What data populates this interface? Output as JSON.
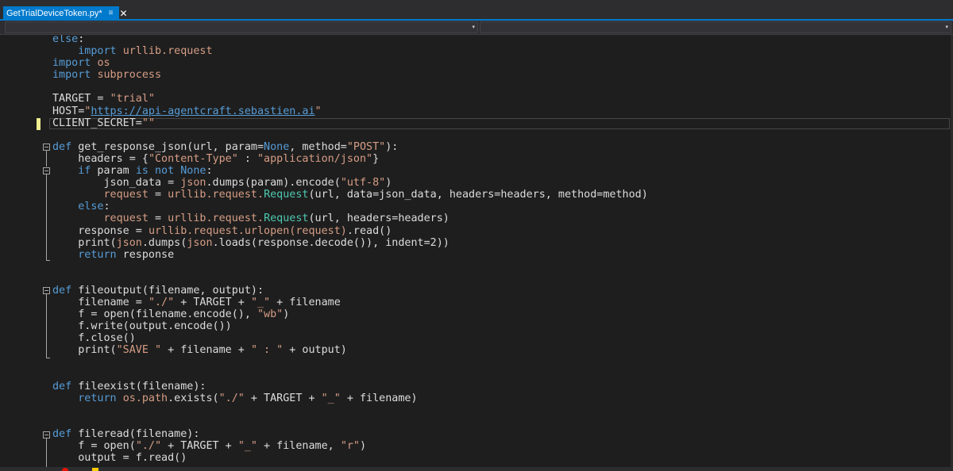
{
  "tab": {
    "title": "GetTrialDeviceToken.py*",
    "pin_glyph": "≡",
    "close_glyph": "✕"
  },
  "navbar": {
    "arrow_glyph": "▾"
  },
  "code": {
    "lines": [
      [
        [
          "kw",
          "else"
        ],
        [
          "t",
          ":"
        ]
      ],
      [
        [
          "t",
          "    "
        ],
        [
          "kw",
          "import"
        ],
        [
          "t",
          " "
        ],
        [
          "str",
          "urllib.request"
        ]
      ],
      [
        [
          "kw",
          "import"
        ],
        [
          "t",
          " "
        ],
        [
          "str",
          "os"
        ]
      ],
      [
        [
          "kw",
          "import"
        ],
        [
          "t",
          " "
        ],
        [
          "str",
          "subprocess"
        ]
      ],
      [],
      [
        [
          "t",
          "TARGET = "
        ],
        [
          "str",
          "\"trial\""
        ]
      ],
      [
        [
          "t",
          "HOST="
        ],
        [
          "str",
          "\""
        ],
        [
          "url",
          "https://api-agentcraft.sebastien.ai"
        ],
        [
          "str",
          "\""
        ]
      ],
      [
        [
          "t",
          "CLIENT_SECRET="
        ],
        [
          "str",
          "\"\""
        ]
      ],
      [],
      [
        [
          "kw",
          "def"
        ],
        [
          "t",
          " get_response_json(url, param="
        ],
        [
          "kw",
          "None"
        ],
        [
          "t",
          ", method="
        ],
        [
          "str",
          "\"POST\""
        ],
        [
          "t",
          "):"
        ]
      ],
      [
        [
          "t",
          "    headers = {"
        ],
        [
          "str",
          "\"Content-Type\""
        ],
        [
          "t",
          " : "
        ],
        [
          "str",
          "\"application/json\""
        ],
        [
          "t",
          "}"
        ]
      ],
      [
        [
          "t",
          "    "
        ],
        [
          "kw",
          "if"
        ],
        [
          "t",
          " param "
        ],
        [
          "kw",
          "is not None"
        ],
        [
          "t",
          ":"
        ]
      ],
      [
        [
          "t",
          "        json_data = "
        ],
        [
          "str",
          "json"
        ],
        [
          "t",
          ".dumps(param).encode("
        ],
        [
          "str",
          "\"utf-8\""
        ],
        [
          "t",
          ")"
        ]
      ],
      [
        [
          "t",
          "        "
        ],
        [
          "str",
          "request"
        ],
        [
          "t",
          " = "
        ],
        [
          "str",
          "urllib.request."
        ],
        [
          "cls",
          "Request"
        ],
        [
          "t",
          "(url, data=json_data, headers=headers, method=method)"
        ]
      ],
      [
        [
          "t",
          "    "
        ],
        [
          "kw",
          "else"
        ],
        [
          "t",
          ":"
        ]
      ],
      [
        [
          "t",
          "        "
        ],
        [
          "str",
          "request"
        ],
        [
          "t",
          " = "
        ],
        [
          "str",
          "urllib.request."
        ],
        [
          "cls",
          "Request"
        ],
        [
          "t",
          "(url, headers=headers)"
        ]
      ],
      [
        [
          "t",
          "    response = "
        ],
        [
          "str",
          "urllib.request.urlopen(request)"
        ],
        [
          "t",
          ".read()"
        ]
      ],
      [
        [
          "t",
          "    print("
        ],
        [
          "str",
          "json"
        ],
        [
          "t",
          ".dumps("
        ],
        [
          "str",
          "json"
        ],
        [
          "t",
          ".loads(response.decode()), indent=2))"
        ]
      ],
      [
        [
          "t",
          "    "
        ],
        [
          "kw",
          "return"
        ],
        [
          "t",
          " response"
        ]
      ],
      [],
      [],
      [
        [
          "kw",
          "def"
        ],
        [
          "t",
          " fileoutput(filename, output):"
        ]
      ],
      [
        [
          "t",
          "    filename = "
        ],
        [
          "str",
          "\"./\""
        ],
        [
          "t",
          " + TARGET + "
        ],
        [
          "str",
          "\"_\""
        ],
        [
          "t",
          " + filename"
        ]
      ],
      [
        [
          "t",
          "    f = open(filename.encode(), "
        ],
        [
          "str",
          "\"wb\""
        ],
        [
          "t",
          ")"
        ]
      ],
      [
        [
          "t",
          "    f.write(output.encode())"
        ]
      ],
      [
        [
          "t",
          "    f.close()"
        ]
      ],
      [
        [
          "t",
          "    print("
        ],
        [
          "str",
          "\"SAVE \""
        ],
        [
          "t",
          " + filename + "
        ],
        [
          "str",
          "\" : \""
        ],
        [
          "t",
          " + output)"
        ]
      ],
      [],
      [],
      [
        [
          "kw",
          "def"
        ],
        [
          "t",
          " fileexist(filename):"
        ]
      ],
      [
        [
          "t",
          "    "
        ],
        [
          "kw",
          "return"
        ],
        [
          "t",
          " "
        ],
        [
          "str",
          "os.path"
        ],
        [
          "t",
          ".exists("
        ],
        [
          "str",
          "\"./\""
        ],
        [
          "t",
          " + TARGET + "
        ],
        [
          "str",
          "\"_\""
        ],
        [
          "t",
          " + filename)"
        ]
      ],
      [],
      [],
      [
        [
          "kw",
          "def"
        ],
        [
          "t",
          " fileread(filename):"
        ]
      ],
      [
        [
          "t",
          "    f = open("
        ],
        [
          "str",
          "\"./\""
        ],
        [
          "t",
          " + TARGET + "
        ],
        [
          "str",
          "\"_\""
        ],
        [
          "t",
          " + filename, "
        ],
        [
          "str",
          "\"r\""
        ],
        [
          "t",
          ")"
        ]
      ],
      [
        [
          "t",
          "    output = f.read()"
        ]
      ]
    ]
  }
}
